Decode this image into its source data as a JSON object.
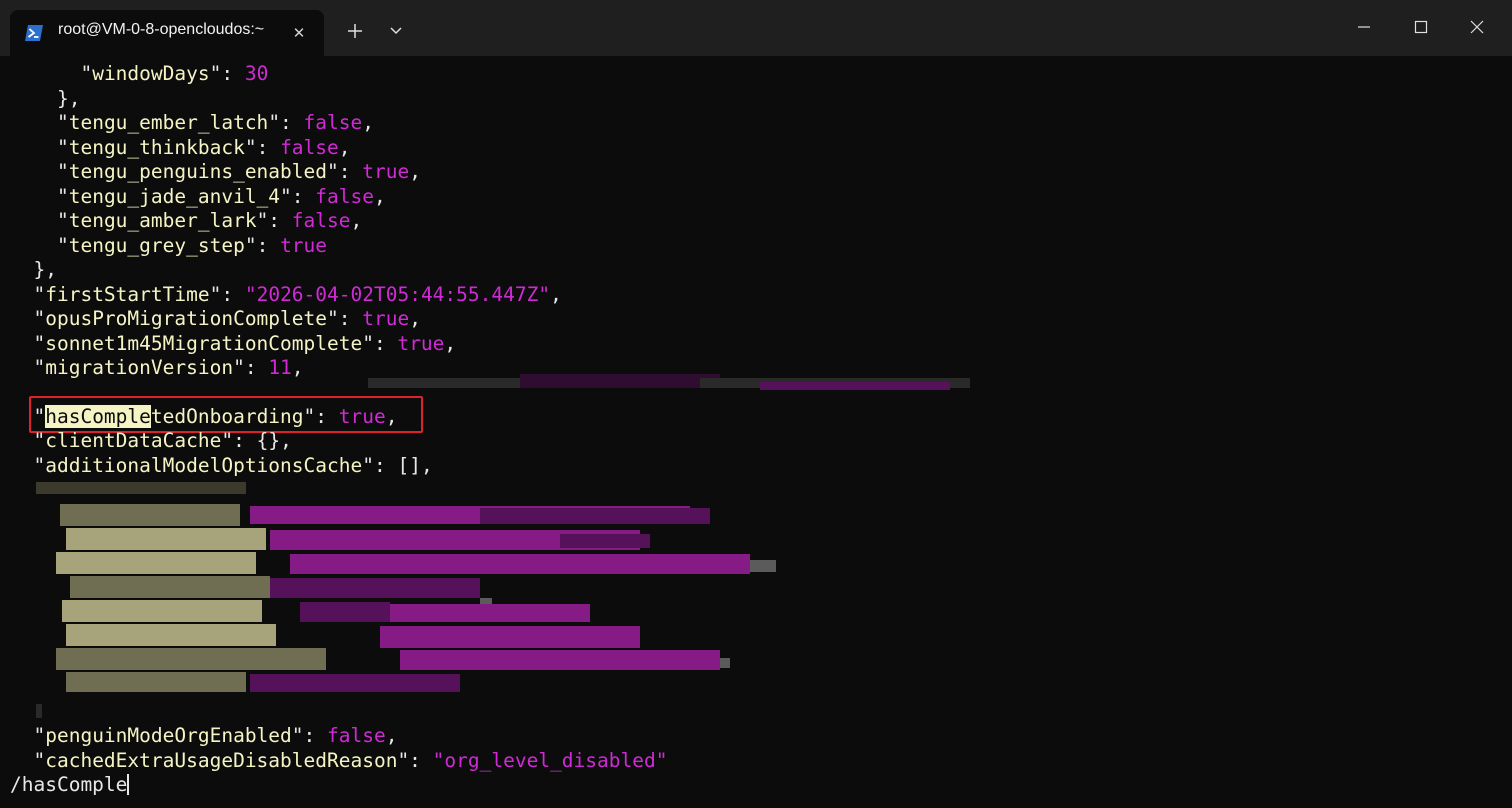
{
  "window": {
    "tab_title": "root@VM-0-8-opencloudos:~",
    "tab_close_glyph": "✕",
    "icons": {
      "tab": "powershell-icon",
      "new_tab": "plus-icon",
      "dropdown": "chevron-down-icon",
      "minimize": "minimize-icon",
      "maximize": "maximize-icon",
      "close": "close-icon"
    }
  },
  "colors": {
    "background": "#0c0c0c",
    "key": "#f5f4c4",
    "value": "#d02ad6",
    "highlight_box": "#e0202a",
    "titlebar": "#1f1f1f"
  },
  "terminal": {
    "l1": {
      "q1": "\"",
      "key": "windowDays",
      "q2": "\": ",
      "val": "30"
    },
    "l2": {
      "text": "},"
    },
    "l3": {
      "q1": "\"",
      "key": "tengu_ember_latch",
      "q2": "\": ",
      "val": "false",
      "end": ","
    },
    "l4": {
      "q1": "\"",
      "key": "tengu_thinkback",
      "q2": "\": ",
      "val": "false",
      "end": ","
    },
    "l5": {
      "q1": "\"",
      "key": "tengu_penguins_enabled",
      "q2": "\": ",
      "val": "true",
      "end": ","
    },
    "l6": {
      "q1": "\"",
      "key": "tengu_jade_anvil_4",
      "q2": "\": ",
      "val": "false",
      "end": ","
    },
    "l7": {
      "q1": "\"",
      "key": "tengu_amber_lark",
      "q2": "\": ",
      "val": "false",
      "end": ","
    },
    "l8": {
      "q1": "\"",
      "key": "tengu_grey_step",
      "q2": "\": ",
      "val": "true"
    },
    "l9": {
      "text": "},"
    },
    "l10": {
      "q1": "\"",
      "key": "firstStartTime",
      "q2": "\": ",
      "val": "\"2026-04-02T05:44:55.447Z\"",
      "end": ","
    },
    "l11": {
      "q1": "\"",
      "key": "opusProMigrationComplete",
      "q2": "\": ",
      "val": "true",
      "end": ","
    },
    "l12": {
      "q1": "\"",
      "key": "sonnet1m45MigrationComplete",
      "q2": "\": ",
      "val": "true",
      "end": ","
    },
    "l13": {
      "q1": "\"",
      "key": "migrationVersion",
      "q2": "\": ",
      "val": "11",
      "end": ","
    },
    "l15": {
      "q1": "\"",
      "key_match": "hasComple",
      "key_rest": "tedOnboarding",
      "q2": "\": ",
      "val": "true",
      "end": ","
    },
    "l16": {
      "q1": "\"",
      "key": "clientDataCache",
      "q2": "\": ",
      "val": "{}",
      "end": ","
    },
    "l17": {
      "q1": "\"",
      "key": "additionalModelOptionsCache",
      "q2": "\": ",
      "val": "[]",
      "end": ","
    },
    "l28": {
      "q1": "\"",
      "key": "penguinModeOrgEnabled",
      "q2": "\": ",
      "val": "false",
      "end": ","
    },
    "l29": {
      "q1": "\"",
      "key": "cachedExtraUsageDisabledReason",
      "q2": "\": ",
      "val": "\"org_level_disabled\""
    },
    "search_prompt": "/hasComple"
  }
}
